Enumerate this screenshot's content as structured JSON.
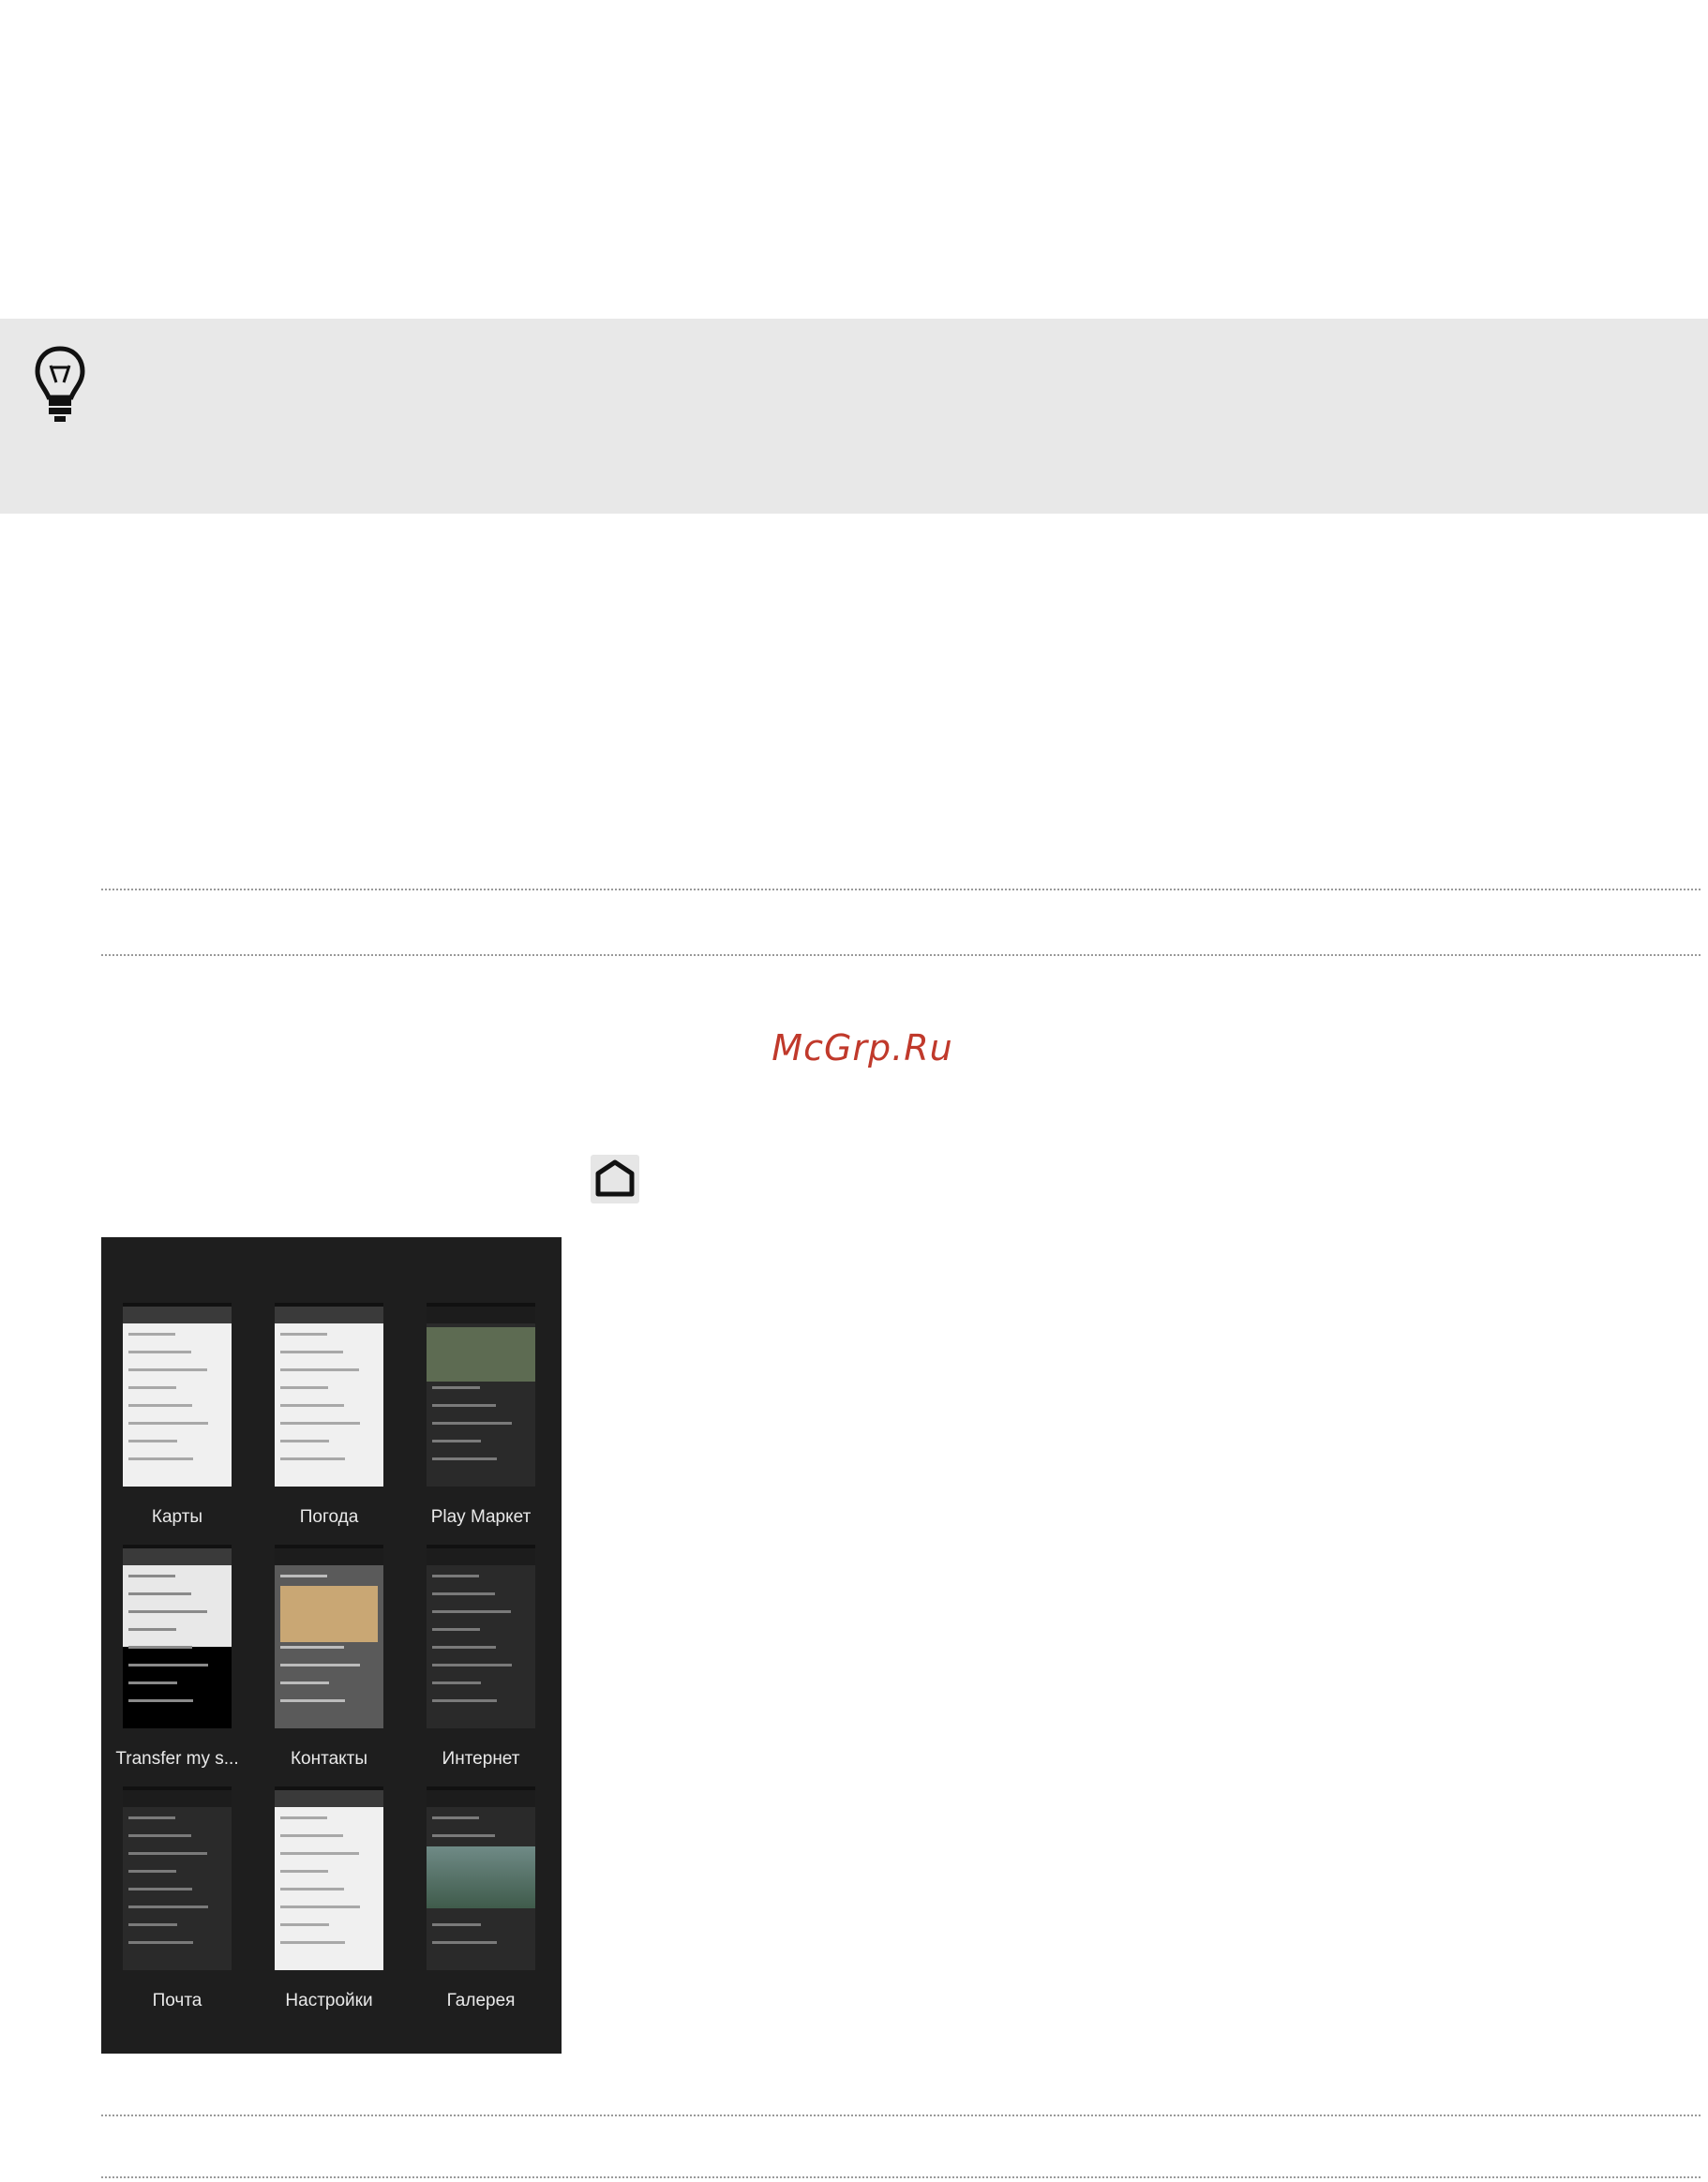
{
  "watermark": "McGrp.Ru",
  "tip": {
    "icon": "lightbulb-icon"
  },
  "home_button": {
    "icon": "home-icon"
  },
  "recent_apps": {
    "apps": [
      {
        "label": "Карты",
        "theme": "light"
      },
      {
        "label": "Погода",
        "theme": "light"
      },
      {
        "label": "Play Маркет",
        "theme": "dark"
      },
      {
        "label": "Transfer my s...",
        "theme": "split"
      },
      {
        "label": "Контакты",
        "theme": "grey"
      },
      {
        "label": "Интернет",
        "theme": "dark"
      },
      {
        "label": "Почта",
        "theme": "dark"
      },
      {
        "label": "Настройки",
        "theme": "light"
      },
      {
        "label": "Галерея",
        "theme": "dark"
      }
    ]
  }
}
